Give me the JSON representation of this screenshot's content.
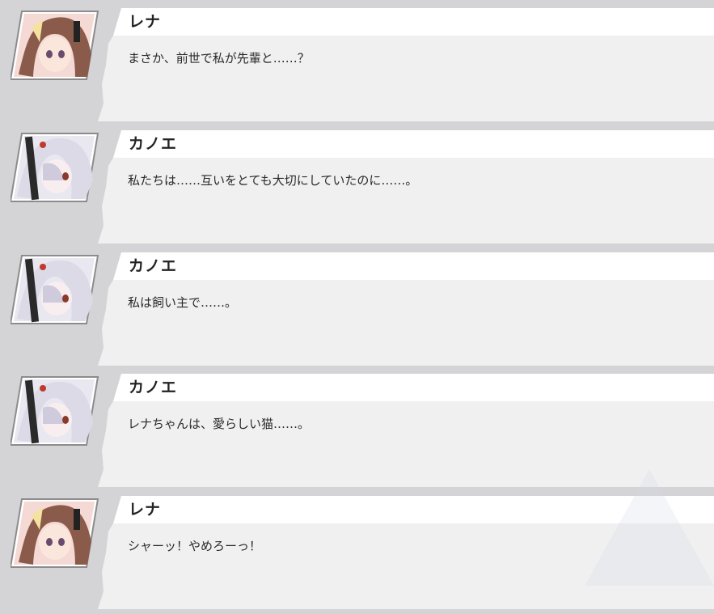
{
  "log": {
    "entries": [
      {
        "speaker": "レナ",
        "text": "まさか、前世で私が先輩と……？",
        "character": "rena"
      },
      {
        "speaker": "カノエ",
        "text": "私たちは……互いをとても大切にしていたのに……。",
        "character": "kanoe"
      },
      {
        "speaker": "カノエ",
        "text": "私は飼い主で……。",
        "character": "kanoe"
      },
      {
        "speaker": "カノエ",
        "text": "レナちゃんは、愛らしい猫……。",
        "character": "kanoe"
      },
      {
        "speaker": "レナ",
        "text": "シャーッ！やめろーっ！",
        "character": "rena"
      }
    ]
  },
  "colors": {
    "background": "#d4d4d7",
    "name_band": "#ffffff",
    "body_panel": "#f0f0f0",
    "rena_hair": "#8a5a4a",
    "kanoe_hair": "#dcdae6"
  }
}
